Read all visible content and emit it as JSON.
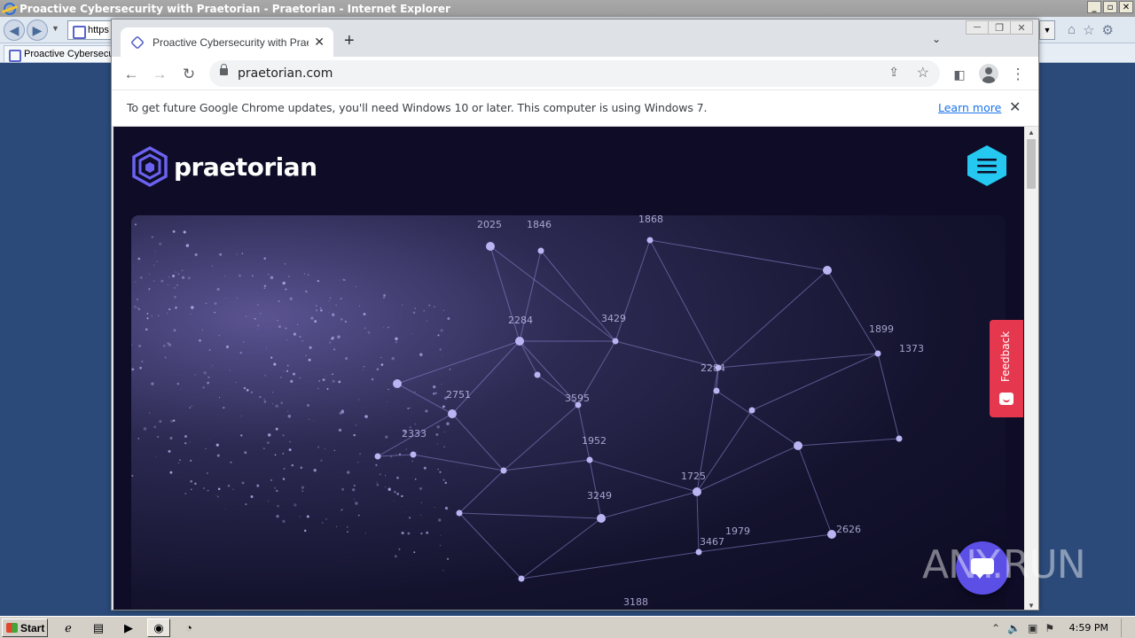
{
  "ie": {
    "window_title": "Proactive Cybersecurity with Praetorian - Praetorian - Internet Explorer",
    "address_text": "https",
    "tab_label": "Proactive Cybersecurity ...",
    "win_controls": [
      "_",
      "▫",
      "✕"
    ]
  },
  "chrome": {
    "tab_title": "Proactive Cybersecurity with Praetorian",
    "url": "praetorian.com",
    "infobar_message": "To get future Google Chrome updates, you'll need Windows 10 or later. This computer is using Windows 7.",
    "infobar_link": "Learn more",
    "icons": [
      "back-arrow-icon",
      "forward-arrow-icon",
      "reload-icon",
      "lock-icon",
      "share-icon",
      "star-icon",
      "side-panel-icon",
      "profile-icon",
      "menu-kebab-icon"
    ]
  },
  "site": {
    "brand": "praetorian",
    "feedback_label": "Feedback",
    "hero_numbers": [
      "2025",
      "1846",
      "1868",
      "2284",
      "3429",
      "1899",
      "1373",
      "2284",
      "3595",
      "2751",
      "2333",
      "1952",
      "1725",
      "3249",
      "3467",
      "1979",
      "2626",
      "3188"
    ],
    "colors": {
      "page_bg": "#0e0c26",
      "menu_button": "#24c8f0",
      "feedback": "#e5374e",
      "chat": "#5b4fe6",
      "logo": "#6b63f0"
    }
  },
  "watermark": "ANY.RUN",
  "taskbar": {
    "start_label": "Start",
    "clock": "4:59 PM"
  }
}
